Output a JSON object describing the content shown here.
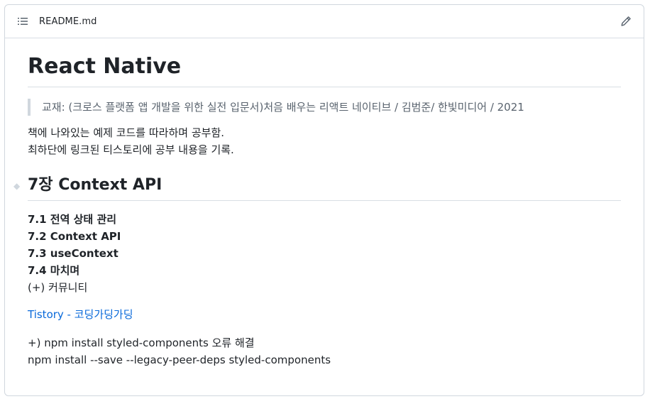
{
  "file": {
    "name": "README.md"
  },
  "readme": {
    "title": "React Native",
    "quote": "교재: (크로스 플랫폼 앱 개발을 위한 실전 입문서)처음 배우는 리액트 네이티브 / 김범준/ 한빛미디어 / 2021",
    "intro_line1": "책에 나와있는 예제 코드를 따라하며 공부함.",
    "intro_line2": "최하단에 링크된 티스토리에 공부 내용을 기록.",
    "section_heading": "7장 Context API",
    "toc": [
      {
        "label": "7.1 전역 상태 관리",
        "bold": true
      },
      {
        "label": "7.2 Context API",
        "bold": true
      },
      {
        "label": "7.3 useContext",
        "bold": true
      },
      {
        "label": "7.4 마치며",
        "bold": true
      },
      {
        "label": "(+) 커뮤니티",
        "bold": false
      }
    ],
    "link_text": "Tistory - 코딩가딩가딩",
    "note_line1": "+) npm install styled-components 오류 해결",
    "note_line2": "npm install --save --legacy-peer-deps styled-components"
  },
  "icons": {
    "toc": "list-unordered-icon",
    "edit": "pencil-icon"
  },
  "colors": {
    "link": "#0969da",
    "border": "#d0d7de",
    "muted": "#59636e"
  }
}
